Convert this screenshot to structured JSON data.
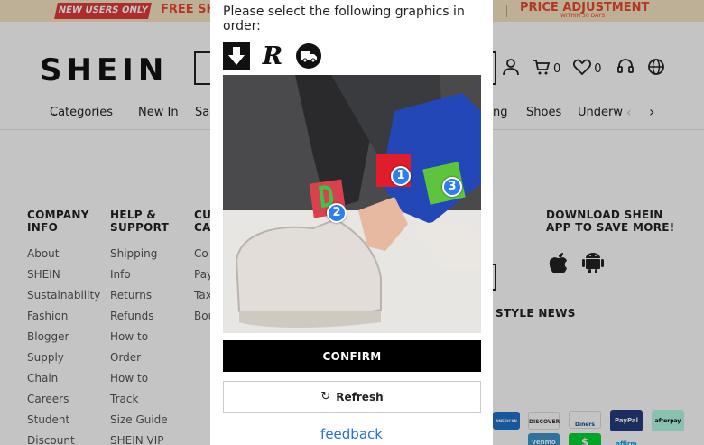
{
  "promo": {
    "new_tag": "NEW USERS ONLY",
    "free_shipping": "FREE SH",
    "price_adjustment": "PRICE ADJUSTMENT",
    "price_adjustment_sub": "WITHIN 30 DAYS"
  },
  "header": {
    "logo": "SHEIN",
    "cart_count": "0",
    "wishlist_count": "0",
    "icons": [
      "user-icon",
      "cart-icon",
      "heart-icon",
      "support-icon",
      "globe-icon"
    ]
  },
  "nav": {
    "items": [
      "Categories",
      "New In",
      "Sa",
      "ng",
      "Shoes",
      "Underw"
    ]
  },
  "footer": {
    "col1": {
      "title": "COMPANY INFO",
      "links": [
        "About",
        "SHEIN",
        "Sustainability",
        "Fashion",
        "Blogger",
        "Supply",
        "Chain",
        "Careers",
        "Student",
        "Discount"
      ]
    },
    "col2": {
      "title": "HELP & SUPPORT",
      "links": [
        "Shipping",
        "Info",
        "Returns",
        "Refunds",
        "How to",
        "Order",
        "How to",
        "Track",
        "Size Guide",
        "SHEIN VIP"
      ]
    },
    "col3": {
      "title": "CU CA",
      "links": [
        "Co",
        "Pay",
        "Tax",
        "Bou"
      ]
    },
    "app_download": "DOWNLOAD SHEIN APP TO SAVE MORE!",
    "style_news": "STYLE NEWS",
    "payments": [
      "AMERICAN EXPRESS",
      "DISCOVER",
      "Diners Club",
      "PayPal",
      "afterpay",
      "venmo",
      "affirm"
    ]
  },
  "captcha": {
    "instruction": "Please select the following graphics in order:",
    "reference_icons": [
      "download-arrow-icon",
      "letter-r-icon",
      "truck-icon"
    ],
    "reference_letter": "R",
    "markers": [
      "1",
      "2",
      "3"
    ],
    "confirm_label": "CONFIRM",
    "refresh_label": "Refresh",
    "feedback_label": "feedback",
    "colors": {
      "marker": "#2d7ff0",
      "confirm_bg": "#000000",
      "link": "#2a6fd6"
    }
  }
}
